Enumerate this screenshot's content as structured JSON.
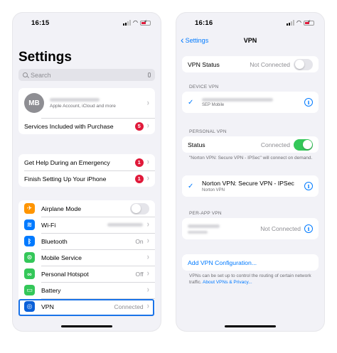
{
  "left": {
    "time": "16:15",
    "title": "Settings",
    "search_placeholder": "Search",
    "profile": {
      "initials": "MB",
      "subtitle": "Apple Account, iCloud and more"
    },
    "services": {
      "label": "Services Included with Purchase",
      "badge": "5"
    },
    "help": [
      {
        "label": "Get Help During an Emergency",
        "badge": "1"
      },
      {
        "label": "Finish Setting Up Your iPhone",
        "badge": "1"
      }
    ],
    "settings": [
      {
        "label": "Airplane Mode",
        "value": "",
        "icon": "airplane-icon",
        "color": "#ff9500",
        "glyph": "✈"
      },
      {
        "label": "Wi-Fi",
        "value": "",
        "icon": "wifi-icon",
        "color": "#007aff",
        "glyph": "≋"
      },
      {
        "label": "Bluetooth",
        "value": "On",
        "icon": "bluetooth-icon",
        "color": "#007aff",
        "glyph": "ᛒ"
      },
      {
        "label": "Mobile Service",
        "value": "",
        "icon": "antenna-icon",
        "color": "#34c759",
        "glyph": "⊙"
      },
      {
        "label": "Personal Hotspot",
        "value": "Off",
        "icon": "link-icon",
        "color": "#34c759",
        "glyph": "∞"
      },
      {
        "label": "Battery",
        "value": "",
        "icon": "battery-icon",
        "color": "#34c759",
        "glyph": "▭"
      },
      {
        "label": "VPN",
        "value": "Connected",
        "icon": "vpn-icon",
        "color": "#0a60d8",
        "glyph": "◎"
      }
    ]
  },
  "right": {
    "time": "16:16",
    "back_label": "Settings",
    "title": "VPN",
    "vpn_status": {
      "label": "VPN Status",
      "value": "Not Connected"
    },
    "device_vpn": {
      "header": "DEVICE VPN",
      "sub": "SEP Mobile"
    },
    "personal_vpn": {
      "header": "PERSONAL VPN",
      "status_label": "Status",
      "status_value": "Connected",
      "note": "\"Norton VPN: Secure VPN - IPSec\" will connect on demand.",
      "profile_name": "Norton VPN: Secure VPN - IPSec",
      "profile_sub": "Norton VPN"
    },
    "per_app": {
      "header": "PER-APP VPN",
      "value": "Not Connected"
    },
    "add_config": "Add VPN Configuration...",
    "footer_text": "VPNs can be set up to control the routing of certain network traffic.",
    "footer_link": "About VPNs & Privacy..."
  }
}
